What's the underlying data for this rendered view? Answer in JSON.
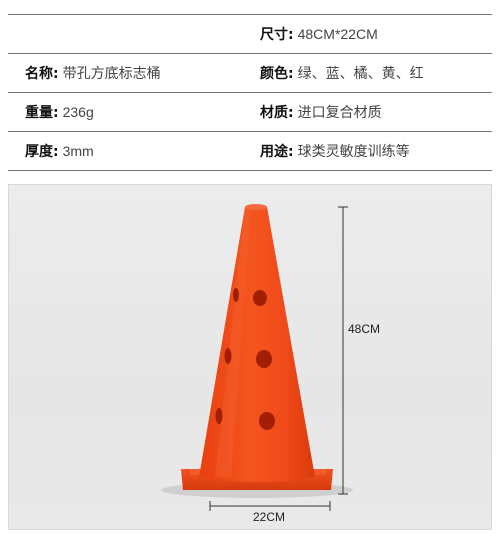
{
  "specs": {
    "rows": [
      {
        "left": {
          "label": "",
          "value": ""
        },
        "right": {
          "label": "尺寸:",
          "value": "48CM*22CM"
        }
      },
      {
        "left": {
          "label": "名称:",
          "value": "带孔方底标志桶"
        },
        "right": {
          "label": "颜色:",
          "value": "绿、蓝、橘、黄、红"
        }
      },
      {
        "left": {
          "label": "重量:",
          "value": "236g"
        },
        "right": {
          "label": "材质:",
          "value": "进口复合材质"
        }
      },
      {
        "left": {
          "label": "厚度:",
          "value": "3mm"
        },
        "right": {
          "label": "用途:",
          "value": "球类灵敏度训练等"
        }
      }
    ]
  },
  "product_image": {
    "height_label": "48CM",
    "width_label": "22CM",
    "cone_color": "#f04a1a"
  }
}
